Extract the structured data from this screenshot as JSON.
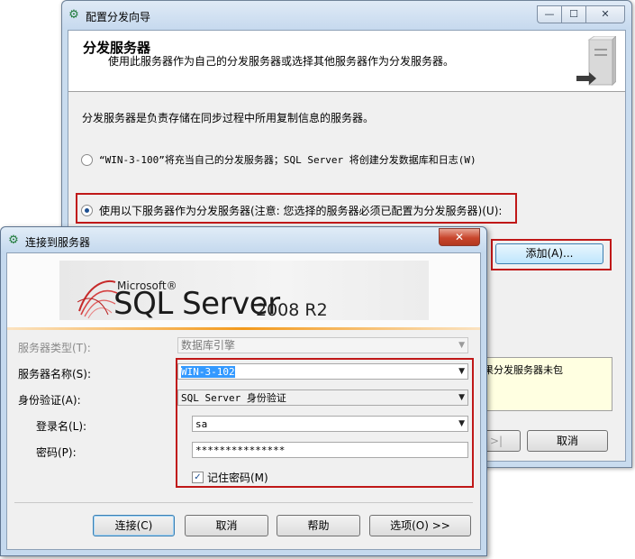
{
  "wizard": {
    "title": "配置分发向导",
    "caption_buttons": {
      "minimize": "—",
      "maximize": "☐",
      "close": "✕"
    },
    "header_title": "分发服务器",
    "header_subtitle": "使用此服务器作为自己的分发服务器或选择其他服务器作为分发服务器。",
    "description": "分发服务器是负责存储在同步过程中所用复制信息的服务器。",
    "option_self": "“WIN-3-100”将充当自己的分发服务器；SQL Server 将创建分发数据库和日志(W)",
    "option_other": "使用以下服务器作为分发服务器(注意: 您选择的服务器必须已配置为分发服务器)(U):",
    "add_button": "添加(A)...",
    "info_text": "如果分发服务器未包",
    "next_button_partial": ">|",
    "cancel_button": "取消"
  },
  "connect": {
    "title": "连接到服务器",
    "close_symbol": "✕",
    "banner": {
      "microsoft": "Microsoft®",
      "product": "SQL Server",
      "version": "2008 R2"
    },
    "server_type": {
      "label": "服务器类型(T):",
      "value": "数据库引擎"
    },
    "server_name": {
      "label": "服务器名称(S):",
      "value": "WIN-3-102"
    },
    "auth": {
      "label": "身份验证(A):",
      "value": "SQL Server 身份验证"
    },
    "login": {
      "label": "登录名(L):",
      "value": "sa"
    },
    "password": {
      "label": "密码(P):",
      "value": "***************"
    },
    "remember_password": "记住密码(M)",
    "buttons": {
      "connect": "连接(C)",
      "cancel": "取消",
      "help": "帮助",
      "options": "选项(O) >>"
    }
  }
}
